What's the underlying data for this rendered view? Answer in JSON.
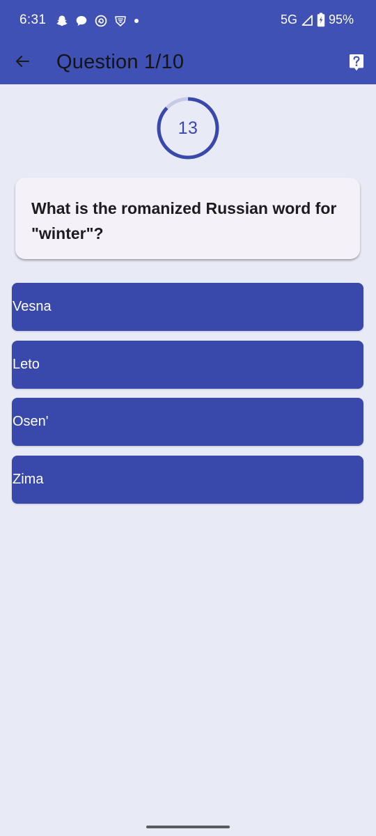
{
  "status_bar": {
    "time": "6:31",
    "network": "5G",
    "battery": "95%"
  },
  "app_bar": {
    "title": "Question 1/10",
    "back_icon": "arrow-left-icon",
    "help_icon": "help-box-icon"
  },
  "timer": {
    "value": "13",
    "progress_fraction": 0.87
  },
  "question": {
    "text": "What is the romanized Russian word for \"winter\"?"
  },
  "answers": [
    {
      "label": "Vesna"
    },
    {
      "label": "Leto"
    },
    {
      "label": "Osen'"
    },
    {
      "label": "Zima"
    }
  ],
  "colors": {
    "primary": "#3f51b5",
    "button": "#3949ab",
    "background": "#e8eaf6",
    "card": "#f4f1f8",
    "timer_track": "#c5cae9"
  }
}
